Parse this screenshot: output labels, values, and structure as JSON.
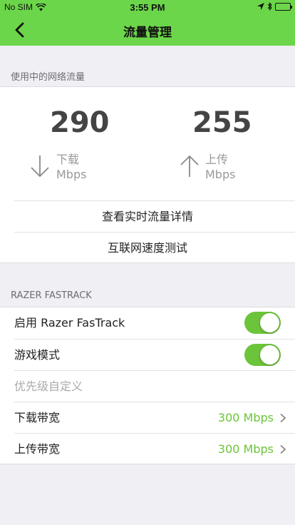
{
  "status_bar": {
    "carrier": "No SIM",
    "time": "3:55 PM",
    "icons": [
      "wifi-icon",
      "location-icon",
      "bluetooth-icon",
      "battery-icon"
    ]
  },
  "nav": {
    "title": "流量管理",
    "back_icon": "chevron-left-icon"
  },
  "traffic": {
    "section_header": "使用中的网络流量",
    "download": {
      "value": "290",
      "label": "下载",
      "unit": "Mbps"
    },
    "upload": {
      "value": "255",
      "label": "上传",
      "unit": "Mbps"
    },
    "actions": [
      "查看实时流量详情",
      "互联网速度测试"
    ]
  },
  "fastrack": {
    "section_header": "RAZER FASTRACK",
    "enable": {
      "label": "启用 Razer FasTrack",
      "on": true
    },
    "game_mode": {
      "label": "游戏模式",
      "on": true
    },
    "priority": {
      "label": "优先级自定义"
    },
    "download_bw": {
      "label": "下载带宽",
      "value": "300 Mbps"
    },
    "upload_bw": {
      "label": "上传带宽",
      "value": "300 Mbps"
    }
  },
  "colors": {
    "accent": "#6cd64a",
    "value_green": "#6cc43a",
    "background": "#efeff4"
  }
}
